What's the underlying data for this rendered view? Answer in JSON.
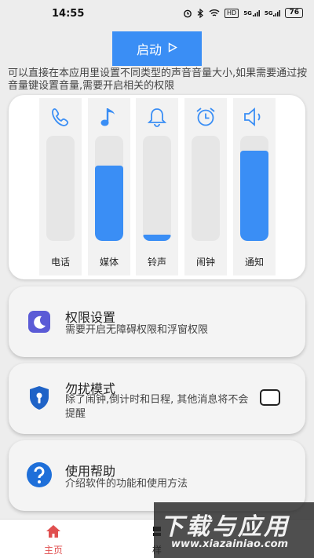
{
  "status_bar": {
    "time": "14:55",
    "hd_label": "HD",
    "signal1": "5G",
    "signal2": "5G",
    "battery": "76"
  },
  "start_button": {
    "label": "启动",
    "icon": "play-icon"
  },
  "intro_text": "可以直接在本应用里设置不同类型的声音音量大小,如果需要通过按音量键设置音量,需要开启相关的权限",
  "volume": {
    "accent_color": "#3a8ef5",
    "channels": [
      {
        "label": "电话",
        "icon": "phone-icon",
        "level": 0.0
      },
      {
        "label": "媒体",
        "icon": "music-note-icon",
        "level": 0.72
      },
      {
        "label": "铃声",
        "icon": "bell-icon",
        "level": 0.06
      },
      {
        "label": "闹钟",
        "icon": "alarm-clock-icon",
        "level": 0.0
      },
      {
        "label": "通知",
        "icon": "speaker-icon",
        "level": 0.86
      }
    ]
  },
  "settings": {
    "permission": {
      "title": "权限设置",
      "desc": "需要开启无障碍权限和浮窗权限",
      "icon": "moon-icon",
      "icon_color": "#5b5bd6"
    },
    "dnd": {
      "title": "勿扰模式",
      "desc": "除了闹钟,倒计时和日程, 其他消息将不会提醒",
      "icon": "shield-icon",
      "icon_color": "#1f63c7",
      "checked": false
    },
    "help": {
      "title": "使用帮助",
      "desc": "介绍软件的功能和使用方法",
      "icon": "question-icon",
      "icon_color": "#1e6fd9"
    }
  },
  "bottom_nav": {
    "home": {
      "label": "主页",
      "icon": "home-icon",
      "active_color": "#e05050"
    },
    "style": {
      "label": "样",
      "icon": "style-icon"
    }
  },
  "watermark": {
    "text": "下载与应用",
    "url": "www.xiazainiao.com"
  }
}
